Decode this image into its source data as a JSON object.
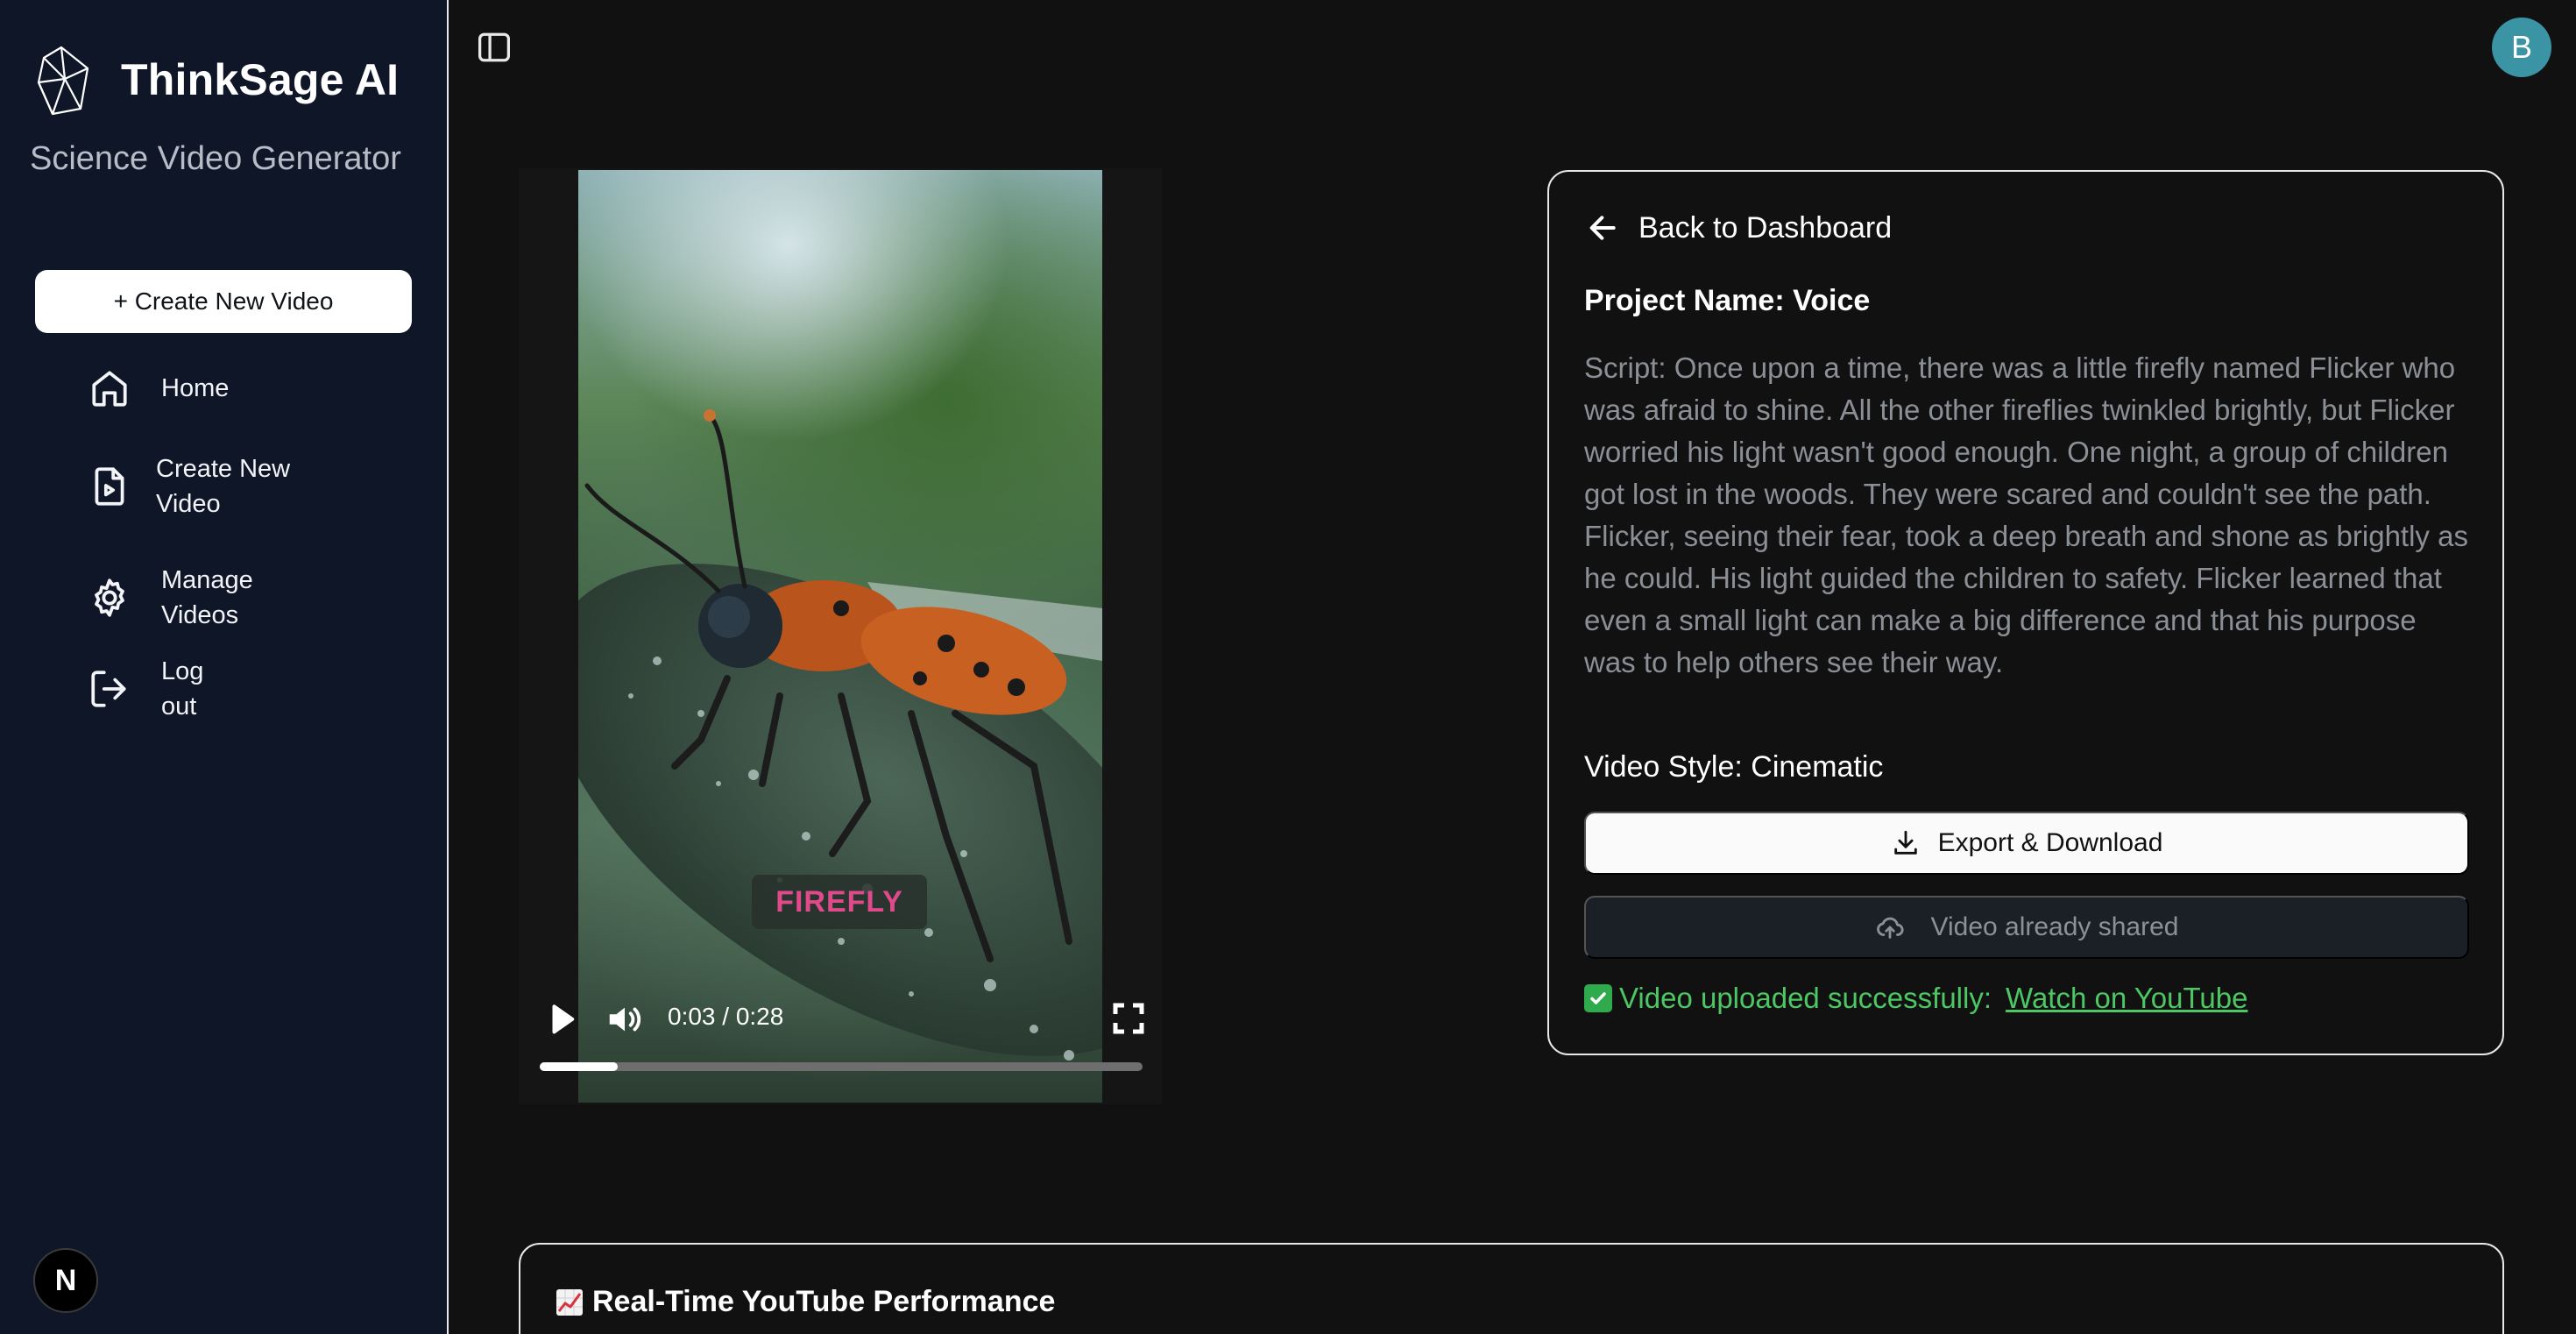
{
  "app": {
    "brand_title": "ThinkSage AI",
    "brand_subtitle": "Science Video Generator",
    "brand_logo": "faceted-gem-logo"
  },
  "sidebar": {
    "create_button_label": "+ Create New Video",
    "items": [
      {
        "label": "Home",
        "icon": "home-icon"
      },
      {
        "label": "Create New Video",
        "icon": "file-video-icon"
      },
      {
        "label": "Manage Videos",
        "icon": "gear-icon"
      },
      {
        "label": "Log out",
        "icon": "logout-icon"
      }
    ],
    "framework_badge": "N"
  },
  "topbar": {
    "sidebar_toggle_icon": "sidebar-toggle-icon",
    "avatar_initial": "B",
    "avatar_color": "#3a94a3"
  },
  "player": {
    "caption": "FIREFLY",
    "caption_color": "#e04a8a",
    "time": "0:03 / 0:28",
    "progress": 0.13
  },
  "project": {
    "back_label": "Back to Dashboard",
    "name_line": "Project Name: Voice",
    "script_line": "Script: Once upon a time, there was a little firefly named Flicker who was afraid to shine. All the other fireflies twinkled brightly, but Flicker worried his light wasn't good enough. One night, a group of children got lost in the woods. They were scared and couldn't see the path. Flicker, seeing their fear, took a deep breath and shone as brightly as he could. His light guided the children to safety. Flicker learned that even a small light can make a big difference and that his purpose was to help others see their way.",
    "style_line": "Video Style: Cinematic",
    "export_label": "Export & Download",
    "shared_label": "Video already shared",
    "success_text": "Video uploaded successfully:",
    "youtube_link": "Watch on YouTube",
    "success_color": "#4cc764"
  },
  "performance": {
    "title": "Real-Time YouTube Performance",
    "icon": "chart-increasing-icon"
  }
}
